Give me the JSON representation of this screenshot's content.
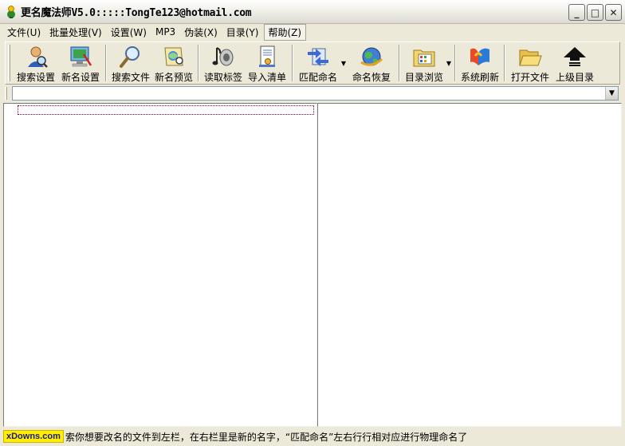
{
  "window": {
    "title": "更名魔法师V5.0:::::TongTe123@hotmail.com",
    "minimize": "_",
    "maximize": "□",
    "close": "✕"
  },
  "menu": [
    {
      "label": "文件(U)"
    },
    {
      "label": "批量处理(V)"
    },
    {
      "label": "设置(W)"
    },
    {
      "label": "MP3"
    },
    {
      "label": "伪装(X)"
    },
    {
      "label": "目录(Y)"
    },
    {
      "label": "帮助(Z)"
    }
  ],
  "toolbar": [
    {
      "label": "搜索设置",
      "icon": "search-settings-icon"
    },
    {
      "label": "新名设置",
      "icon": "new-name-settings-icon"
    },
    {
      "label": "搜索文件",
      "icon": "magnifier-icon"
    },
    {
      "label": "新名预览",
      "icon": "preview-icon"
    },
    {
      "label": "读取标签",
      "icon": "music-speaker-icon"
    },
    {
      "label": "导入清单",
      "icon": "document-import-icon"
    },
    {
      "label": "匹配命名",
      "icon": "match-rename-icon"
    },
    {
      "label": "命名恢复",
      "icon": "globe-restore-icon"
    },
    {
      "label": "目录浏览",
      "icon": "folder-browse-icon"
    },
    {
      "label": "系统刷新",
      "icon": "refresh-icon"
    },
    {
      "label": "打开文件",
      "icon": "open-folder-icon"
    },
    {
      "label": "上级目录",
      "icon": "up-arrow-icon"
    }
  ],
  "path": {
    "value": ""
  },
  "status": {
    "badge": "xDowns.com",
    "text": "索你想要改名的文件到左栏，在右栏里是新的名字，“匹配命名”左右行行相对应进行物理命名了"
  },
  "colors": {
    "accent": "#1a1a8a",
    "badge": "#ffee00",
    "background": "#ece9d8"
  }
}
